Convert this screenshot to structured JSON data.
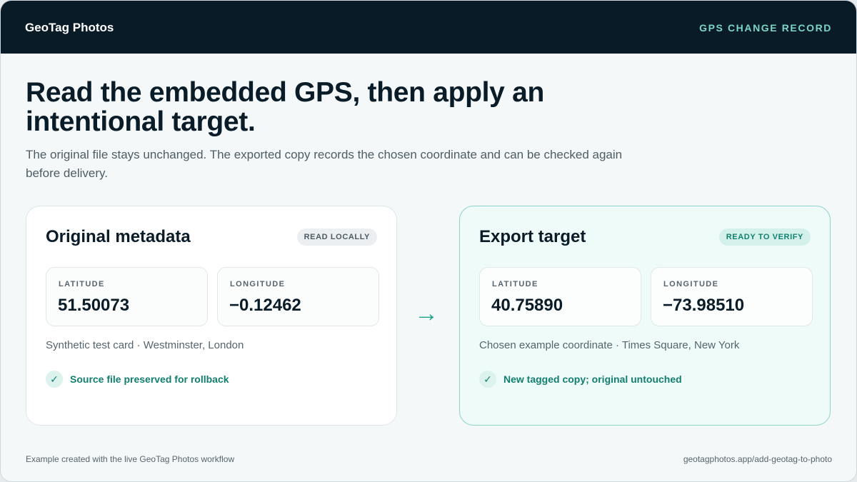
{
  "header": {
    "brand": "GeoTag Photos",
    "record_label": "GPS CHANGE RECORD"
  },
  "main": {
    "headline": "Read the embedded GPS, then apply an intentional target.",
    "intro": "The original file stays unchanged. The exported copy records the chosen coordinate and can be checked again before delivery."
  },
  "original": {
    "title": "Original metadata",
    "badge": "READ LOCALLY",
    "latitude_label": "LATITUDE",
    "latitude": "51.50073",
    "longitude_label": "LONGITUDE",
    "longitude": "−0.12462",
    "caption": "Synthetic test card · Westminster, London",
    "status": "Source file preserved for rollback"
  },
  "transfer": {
    "arrow": "→"
  },
  "target": {
    "title": "Export target",
    "badge": "READY TO VERIFY",
    "latitude_label": "LATITUDE",
    "latitude": "40.75890",
    "longitude_label": "LONGITUDE",
    "longitude": "−73.98510",
    "caption": "Chosen example coordinate · Times Square, New York",
    "status": "New tagged copy; original untouched"
  },
  "icons": {
    "check": "✓"
  },
  "footer": {
    "left": "Example created with the live GeoTag Photos workflow",
    "right": "geotagphotos.app/add-geotag-to-photo"
  },
  "colors": {
    "topbar": "#0a1b28",
    "accent": "#127f6e",
    "record_label": "#7ad6c6",
    "target_card_bg": "#effbf9",
    "target_card_border": "#8fd3c6"
  }
}
